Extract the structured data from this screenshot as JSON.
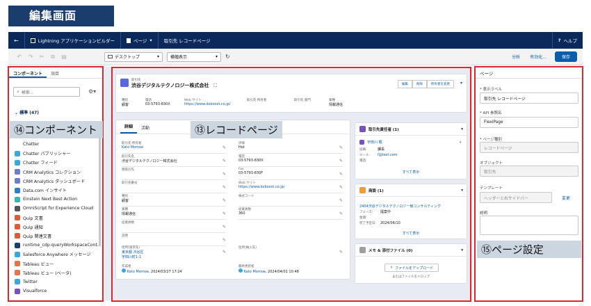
{
  "title_banner": "編集画面",
  "header": {
    "back_icon": "←",
    "app_name": "Lightning アプリケーションビルダー",
    "page_menu": "ページ",
    "page_name": "取引先 レコードページ",
    "help": "ヘルプ"
  },
  "toolbar": {
    "device": "デスクトップ",
    "view": "横幅表示",
    "analyze": "分析",
    "activate": "有効化...",
    "save": "保存"
  },
  "left_panel": {
    "tab_components": "コンポーネント",
    "tab_fields": "項目",
    "search_placeholder": "検索...",
    "standard_header": "標準 (47)",
    "components": [
      {
        "label": "Chatter",
        "color": "#ffffff"
      },
      {
        "label": "Chatter パブリッシャー",
        "color": "#3aa8e0"
      },
      {
        "label": "Chatter フィード",
        "color": "#3aa8e0"
      },
      {
        "label": "CRM Analytics コレクション",
        "color": "#6f7ccb"
      },
      {
        "label": "CRM Analytics ダッシュボード",
        "color": "#6f7ccb"
      },
      {
        "label": "Data.com インサイト",
        "color": "#2f7bd1"
      },
      {
        "label": "Einstein Next Best Action",
        "color": "#3ab5b0"
      },
      {
        "label": "OmniScript for Experience Cloud",
        "color": "#555555"
      },
      {
        "label": "Quip 文書",
        "color": "#e05a3a"
      },
      {
        "label": "Quip 通知",
        "color": "#e05a3a"
      },
      {
        "label": "Quip 関連文書",
        "color": "#e05a3a"
      },
      {
        "label": "runtime_cdp:queryWorkspaceCont...",
        "color": "#1b3d6d"
      },
      {
        "label": "Salesforce Anywhere メッセージ",
        "color": "#3aa8e0"
      },
      {
        "label": "Tableau ビュー",
        "color": "#e5744a"
      },
      {
        "label": "Tableau ビュー (ベータ)",
        "color": "#e5744a"
      },
      {
        "label": "Twitter",
        "color": "#3aa8e0"
      },
      {
        "label": "Visualforce",
        "color": "#7b4fbd"
      }
    ]
  },
  "record": {
    "object_label": "取引先",
    "name": "渋谷デジタルテクノロジー株式会社",
    "buttons": [
      "編集",
      "削除",
      "所有者を変更"
    ],
    "highlights": [
      {
        "label": "種別",
        "value": "顧客",
        "link": false
      },
      {
        "label": "電話",
        "value": "03-5793-830X",
        "link": false
      },
      {
        "label": "Web サイト",
        "value": "https://www.dxboost.co.jp/",
        "link": true
      },
      {
        "label": "取引先 所有者",
        "value": "",
        "link": false
      },
      {
        "label": "取引先 部門",
        "value": "",
        "link": false
      },
      {
        "label": "業種",
        "value": "情報通信",
        "link": false
      }
    ]
  },
  "detail": {
    "tab_detail": "詳細",
    "tab_activity": "活動",
    "left_fields": [
      {
        "label": "取引先 所有者",
        "value": "Kato Momoe",
        "link": true
      },
      {
        "label": "取引先名",
        "value": "渋谷デジタルテクノロジー株式会社",
        "link": false
      },
      {
        "label": "親取引先",
        "value": "",
        "link": false
      },
      {
        "label": "取引先番号",
        "value": "",
        "link": false
      },
      {
        "label": "種別",
        "value": "顧客",
        "link": false
      },
      {
        "label": "業種",
        "value": "情報通信",
        "link": false
      },
      {
        "label": "従業員数",
        "value": "",
        "link": false
      },
      {
        "label": "説明",
        "value": "",
        "link": false
      }
    ],
    "right_fields": [
      {
        "label": "評価",
        "value": "Hot",
        "link": false
      },
      {
        "label": "電話",
        "value": "03-5793-830X",
        "link": false
      },
      {
        "label": "Fax",
        "value": "03-5793-830F",
        "link": false
      },
      {
        "label": "Web サイト",
        "value": "https://www.dxboost.co.jp/",
        "link": true
      },
      {
        "label": "株式コード",
        "value": "",
        "link": false
      },
      {
        "label": "従業員数",
        "value": "360",
        "link": false
      }
    ],
    "address_label": "住所(請求先)",
    "address_lines": [
      "東京都 渋谷区",
      "宇田川町1-1"
    ],
    "address2_label": "住所(納入先)",
    "created_label": "作成者",
    "created_by": "Kato Momoe",
    "created_date": ", 2024/03/27 17:24",
    "modified_label": "最終更新者",
    "modified_by": "Kato Momoe",
    "modified_date": ", 2024/04/01 10:48"
  },
  "contacts_card": {
    "title": "取引先責任者 (1)",
    "name": "宇田川 楓",
    "role_label": "役職:",
    "role_value": "課長",
    "email_label": "メール:",
    "email_value": "f@test.com",
    "phone_label": "電話:",
    "view_all": "すべて表示"
  },
  "opp_card": {
    "title": "商談 (1)",
    "name": "2404渋谷デジタルテクノロジー様コンサルティング",
    "phase_label": "フェーズ:",
    "phase_value": "提案中",
    "amount_label": "金額:",
    "close_label": "完了予定日:",
    "close_value": "2024/06/10",
    "view_all": "すべて表示"
  },
  "files_card": {
    "title": "メモ & 添付ファイル (0)",
    "upload_button": "ファイルをアップロード",
    "drop_text": "またはファイルをドロップ"
  },
  "right_panel": {
    "section_title": "ページ",
    "label_label": "* 表示ラベル",
    "label_value": "取引先 レコードページ",
    "api_label": "* API 参照名",
    "api_value": "FlexiPage",
    "type_label": "* ページ種別",
    "type_value": "レコードページ",
    "object_label": "オブジェクト",
    "object_value": "取引先",
    "template_label": "テンプレート",
    "template_value": "ヘッダーと右サイドバー",
    "change_link": "変更",
    "desc_label": "説明"
  },
  "annotations": {
    "components": "⑭コンポーネント",
    "record_page": "⑬レコードページ",
    "page_settings": "⑮ページ設定"
  }
}
